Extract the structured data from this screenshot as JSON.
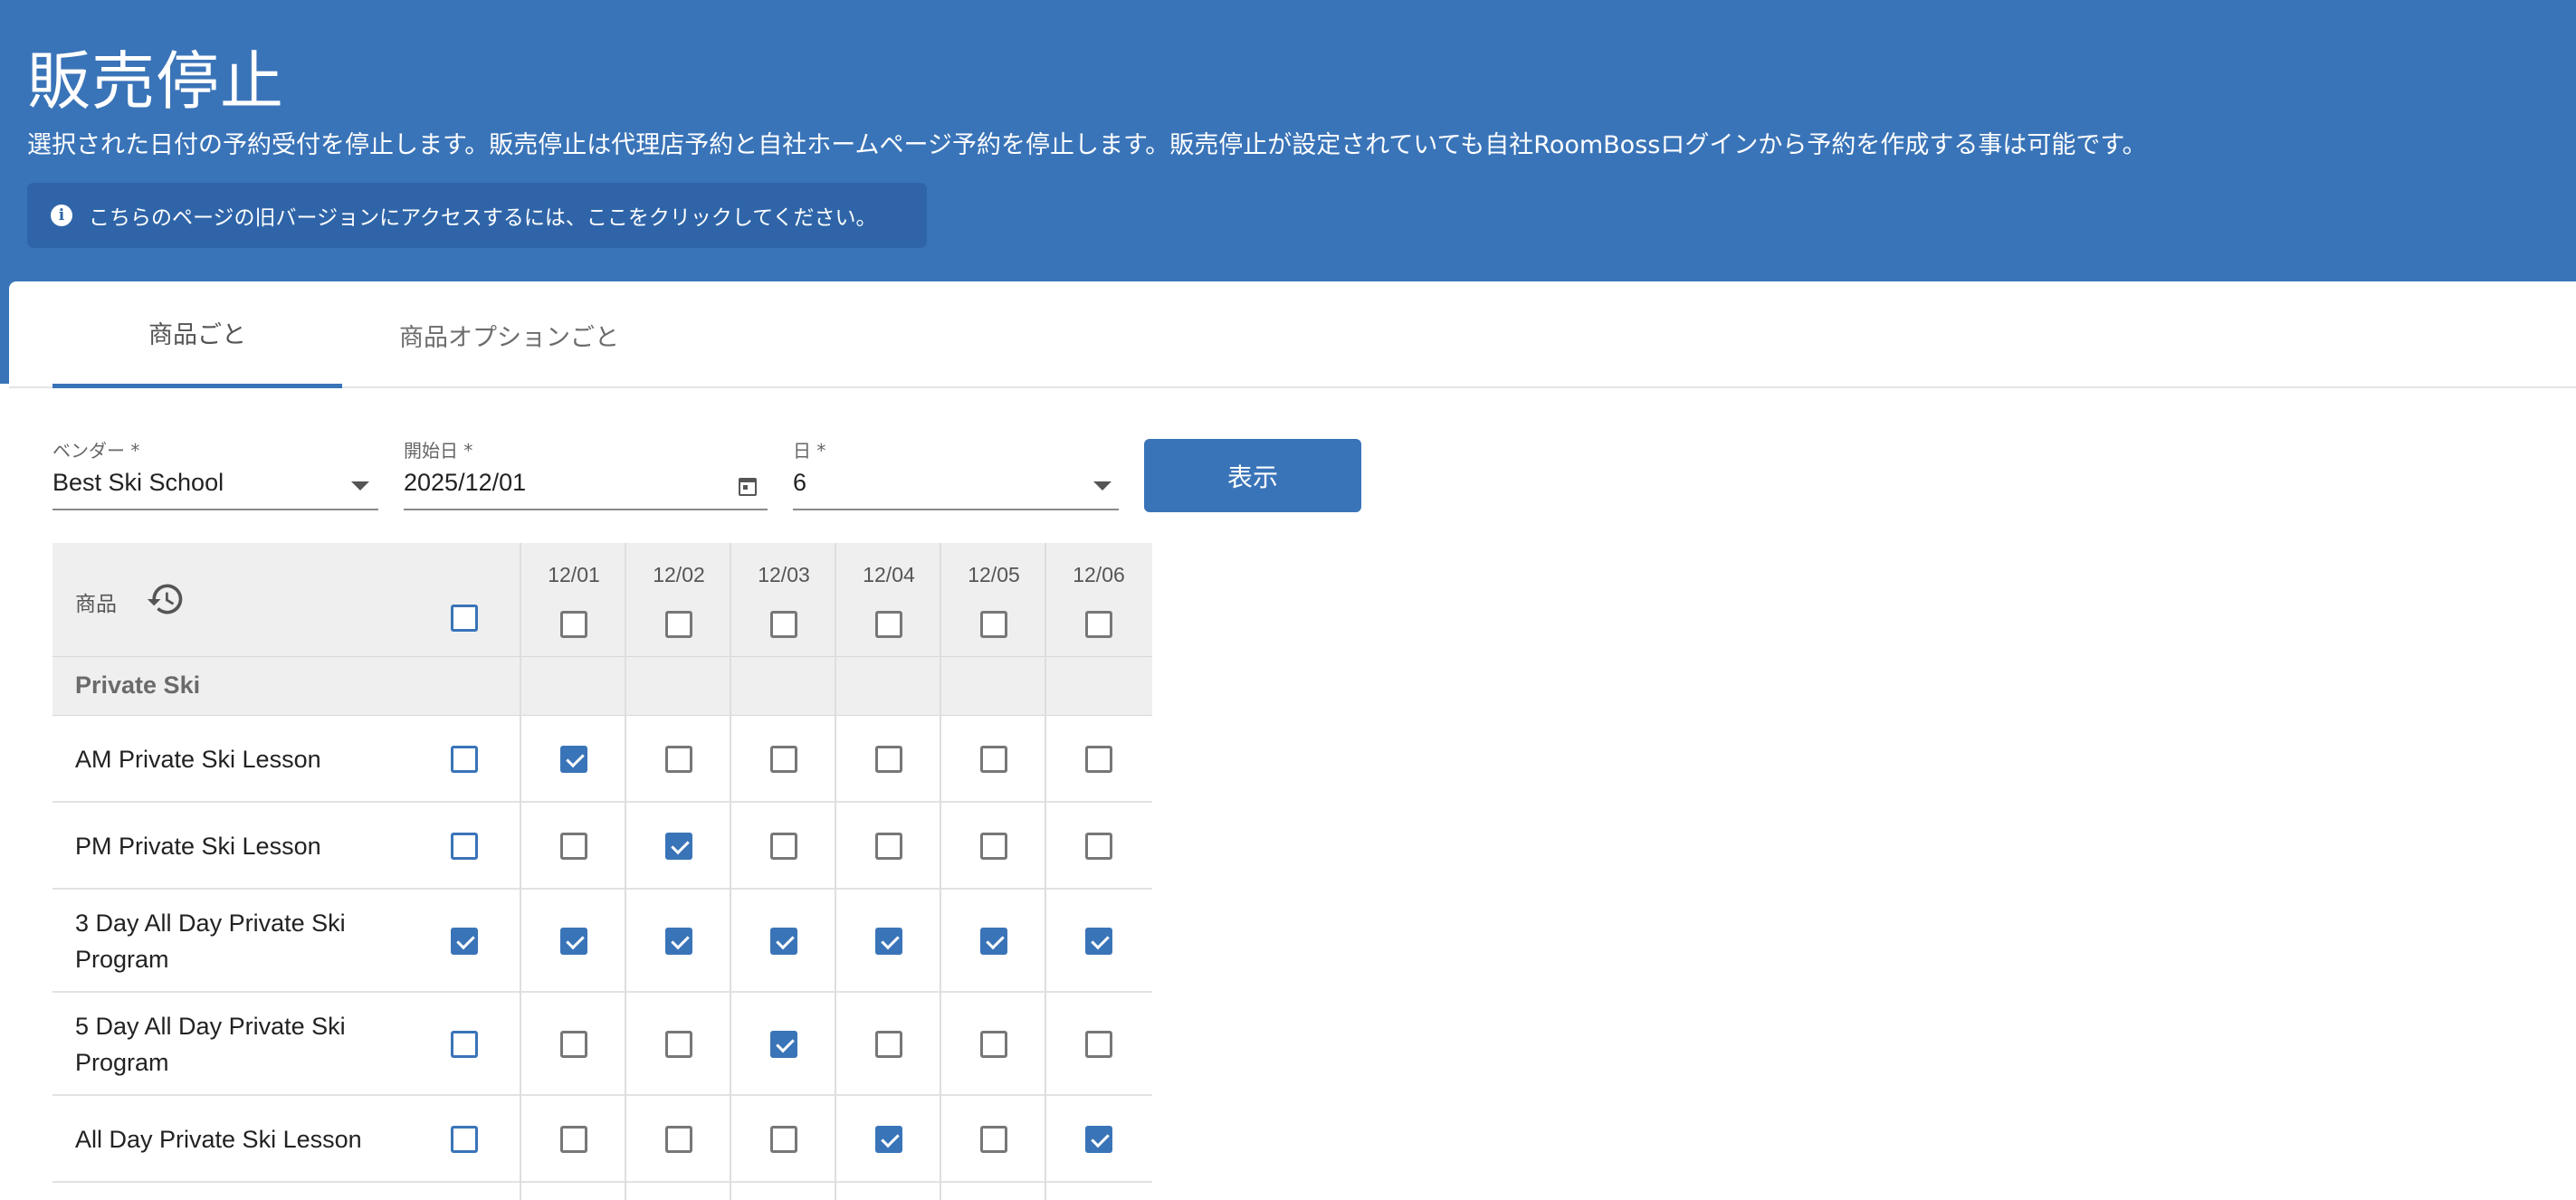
{
  "header": {
    "title": "販売停止",
    "description": "選択された日付の予約受付を停止します。販売停止は代理店予約と自社ホームページ予約を停止します。販売停止が設定されていても自社RoomBossログインから予約を作成する事は可能です。",
    "notice": "こちらのページの旧バージョンにアクセスするには、ここをクリックしてください。"
  },
  "tabs": [
    {
      "label": "商品ごと",
      "active": true
    },
    {
      "label": "商品オプションごと",
      "active": false
    }
  ],
  "form": {
    "vendor_label": "ベンダー *",
    "vendor_value": "Best Ski School",
    "start_label": "開始日 *",
    "start_value": "2025/12/01",
    "days_label": "日 *",
    "days_value": "6",
    "show_button": "表示"
  },
  "table": {
    "product_header": "商品",
    "dates": [
      "12/01",
      "12/02",
      "12/03",
      "12/04",
      "12/05",
      "12/06"
    ],
    "groups": [
      {
        "name": "Private Ski",
        "rows": [
          {
            "label": "AM Private Ski Lesson",
            "all": false,
            "days": [
              true,
              false,
              false,
              false,
              false,
              false
            ]
          },
          {
            "label": "PM Private Ski Lesson",
            "all": false,
            "days": [
              false,
              true,
              false,
              false,
              false,
              false
            ]
          },
          {
            "label": "3 Day All Day Private Ski Program",
            "all": true,
            "days": [
              true,
              true,
              true,
              true,
              true,
              true
            ]
          },
          {
            "label": "5 Day All Day Private Ski Program",
            "all": false,
            "days": [
              false,
              false,
              true,
              false,
              false,
              false
            ]
          },
          {
            "label": "All Day Private Ski Lesson",
            "all": false,
            "days": [
              false,
              false,
              false,
              true,
              false,
              true
            ]
          }
        ]
      }
    ]
  },
  "colors": {
    "primary": "#3a74b8",
    "notice_bg": "#2f65a8",
    "table_header_bg": "#efefef"
  }
}
